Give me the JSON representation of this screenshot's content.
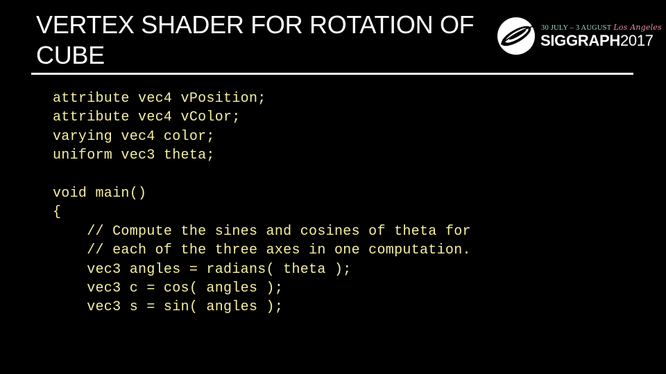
{
  "slide": {
    "title_lines": [
      "VERTEX SHADER FOR ROTATION OF",
      "CUBE"
    ],
    "colors": {
      "background": "#000000",
      "title": "#ffffff",
      "code": "#f5efa0",
      "logo_date": "#9fd8bf",
      "logo_city": "#e98aa6"
    }
  },
  "logo": {
    "icon": "siggraph-swirl-icon",
    "dates": "30 JULY – 3 AUGUST",
    "city": "Los Angeles",
    "brand": "SIGGRAPH",
    "year": "2017"
  },
  "code": {
    "language": "GLSL",
    "lines": [
      "attribute vec4 vPosition;",
      "attribute vec4 vColor;",
      "varying vec4 color;",
      "uniform vec3 theta;",
      "",
      "void main()",
      "{",
      "    // Compute the sines and cosines of theta for",
      "    // each of the three axes in one computation.",
      "    vec3 angles = radians( theta );",
      "    vec3 c = cos( angles );",
      "    vec3 s = sin( angles );"
    ]
  }
}
